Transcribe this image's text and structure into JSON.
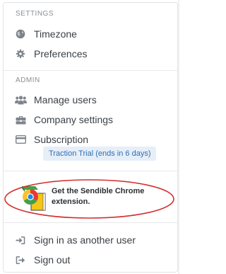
{
  "sections": {
    "settings_header": "SETTINGS",
    "admin_header": "ADMIN"
  },
  "settings_items": [
    {
      "label": "Timezone",
      "icon": "globe-icon"
    },
    {
      "label": "Preferences",
      "icon": "gear-icon"
    }
  ],
  "admin_items": [
    {
      "label": "Manage users",
      "icon": "users-icon"
    },
    {
      "label": "Company settings",
      "icon": "briefcase-icon"
    },
    {
      "label": "Subscription",
      "icon": "credit-card-icon"
    }
  ],
  "subscription_badge": "Traction Trial (ends in 6 days)",
  "promo": {
    "text": "Get the Sendible Chrome extension.",
    "icon": "sendible-chrome-extension-icon",
    "highlight_color": "#d32f2f"
  },
  "account_items": [
    {
      "label": "Sign in as another user",
      "icon": "sign-in-icon"
    },
    {
      "label": "Sign out",
      "icon": "sign-out-icon"
    }
  ],
  "colors": {
    "text": "#3a3f45",
    "muted": "#8a8f96",
    "icon": "#7d838b",
    "badge_bg": "#e6eef8",
    "badge_text": "#2f6fb3"
  }
}
